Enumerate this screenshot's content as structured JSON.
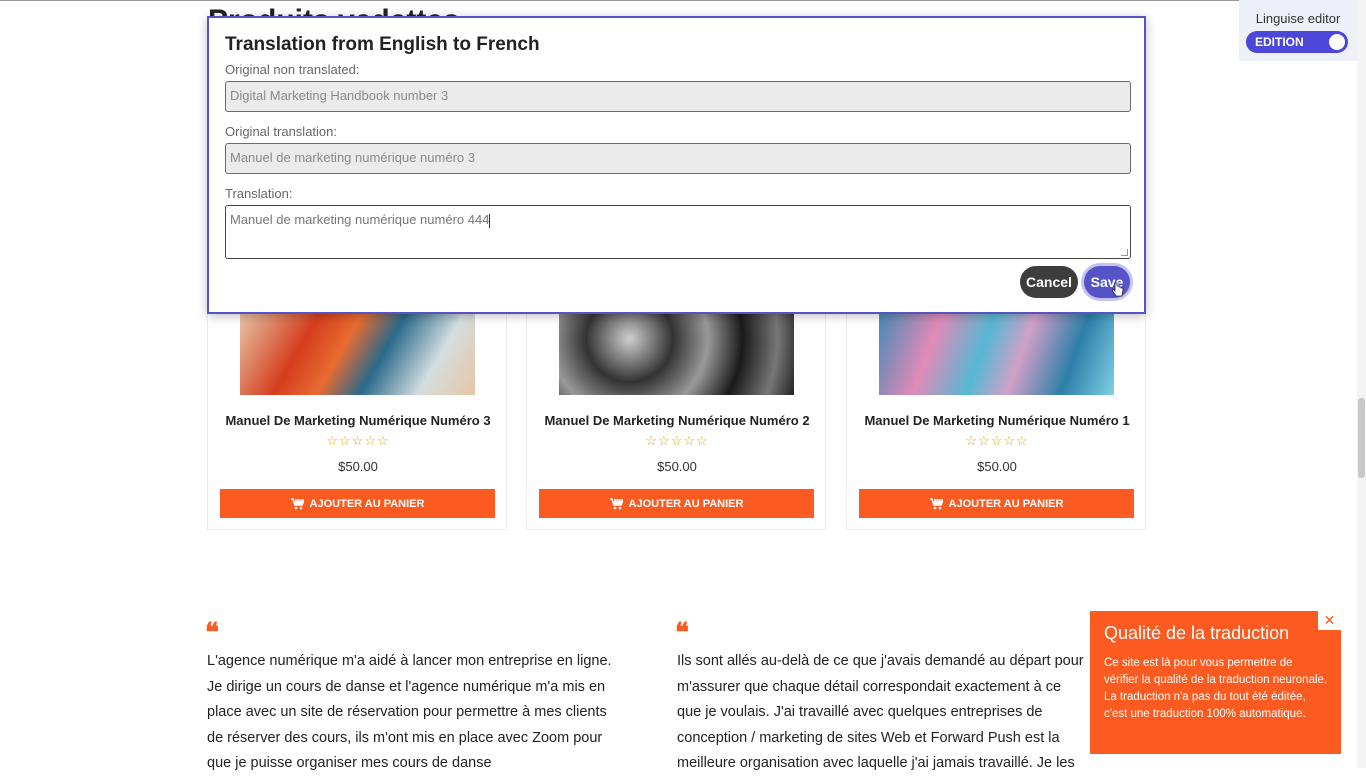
{
  "page": {
    "heading": "Produits vedettes"
  },
  "editor_widget": {
    "label": "Linguise editor",
    "toggle_label": "EDITION",
    "toggle_on": true
  },
  "modal": {
    "title": "Translation from English to French",
    "original_label": "Original non translated:",
    "original_value": "Digital Marketing Handbook number 3",
    "original_translation_label": "Original translation:",
    "original_translation_value": "Manuel de marketing numérique numéro 3",
    "translation_label": "Translation:",
    "translation_value": "Manuel de marketing numérique numéro 444",
    "cancel_label": "Cancel",
    "save_label": "Save"
  },
  "products": [
    {
      "title": "Manuel De Marketing Numérique Numéro 3",
      "rating": "☆☆☆☆☆",
      "price": "$50.00",
      "button": "AJOUTER AU PANIER"
    },
    {
      "title": "Manuel De Marketing Numérique Numéro 2",
      "rating": "☆☆☆☆☆",
      "price": "$50.00",
      "button": "AJOUTER AU PANIER"
    },
    {
      "title": "Manuel De Marketing Numérique Numéro 1",
      "rating": "☆☆☆☆☆",
      "price": "$50.00",
      "button": "AJOUTER AU PANIER"
    }
  ],
  "testimonials": [
    {
      "quote_mark": "❝",
      "text": "L'agence numérique m'a aidé à lancer mon entreprise en ligne. Je dirige un cours de danse et l'agence numérique m'a mis en place avec un site de réservation pour permettre à mes clients de réserver des cours, ils m'ont mis en place avec Zoom pour que je puisse organiser mes cours de danse"
    },
    {
      "quote_mark": "❝",
      "text": "Ils sont allés au-delà de ce que j'avais demandé au départ pour m'assurer que chaque détail correspondait exactement à ce que je voulais. J'ai travaillé avec quelques entreprises de conception / marketing de sites Web et Forward Push est la meilleure organisation avec laquelle j'ai jamais travaillé. Je les"
    }
  ],
  "notice": {
    "title": "Qualité de la traduction",
    "body": "Ce site est là pour vous permettre de vérifier la qualité de la traduction neuronale. La traduction n'a pas du tout été éditée, c'est une traduction 100% automatique.",
    "close_symbol": "✕"
  },
  "colors": {
    "accent": "#fb5b21",
    "editor": "#5653c9"
  }
}
